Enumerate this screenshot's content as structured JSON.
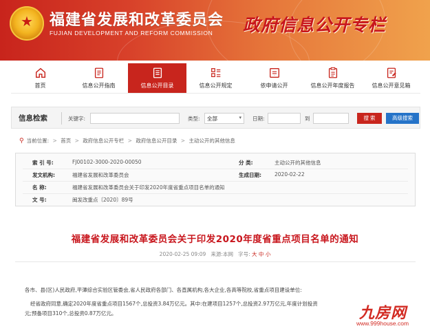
{
  "header": {
    "org_name_cn": "福建省发展和改革委员会",
    "org_name_en": "FUJIAN DEVELOPMENT AND REFORM COMMISSION",
    "column_title": "政府信息公开专栏",
    "brand_color": "#c8251d"
  },
  "nav": {
    "items": [
      {
        "label": "首页",
        "icon": "home-icon"
      },
      {
        "label": "信息公开指南",
        "icon": "guide-icon"
      },
      {
        "label": "信息公开目录",
        "icon": "catalog-icon",
        "active": true
      },
      {
        "label": "信息公开规定",
        "icon": "regulation-icon"
      },
      {
        "label": "依申请公开",
        "icon": "application-icon"
      },
      {
        "label": "信息公开年度报告",
        "icon": "report-icon"
      },
      {
        "label": "信息公开意见箱",
        "icon": "mailbox-icon"
      }
    ]
  },
  "search": {
    "title": "信息检索",
    "keyword_label": "关键字:",
    "keyword_value": "",
    "type_label": "类型:",
    "type_value": "全部",
    "date_label": "日期:",
    "date_to_label": "到",
    "search_button": "搜 索",
    "advanced_button": "高级搜索",
    "search_button_color": "#c8251d",
    "advanced_button_color": "#2573c8"
  },
  "breadcrumb": {
    "prefix": "当前位置:",
    "items": [
      "首页",
      "政府信息公开专栏",
      "政府信息公开目录",
      "主动公开的其他信息"
    ]
  },
  "info": {
    "index_label": "索 引 号:",
    "index_value": "FJ00102-3000-2020-00050",
    "category_label": "分 类:",
    "category_value": "主动公开的其他信息",
    "publisher_label": "发文机构:",
    "publisher_value": "福建省发展和改革委员会",
    "date_label": "生成日期:",
    "date_value": "2020-02-22",
    "name_label": "名 称:",
    "name_value": "福建省发展和改革委员会关于印发2020年度省重点项目名单的通知",
    "docno_label": "文 号:",
    "docno_value": "闽发改重点〔2020〕89号"
  },
  "article": {
    "title": "福建省发展和改革委员会关于印发2020年度省重点项目名单的通知",
    "date": "2020-02-25 09:09",
    "source_label": "来源:",
    "source_value": "本网",
    "size_label": "字号:",
    "size_large": "大",
    "size_medium": "中",
    "size_small": "小",
    "paragraph_1": "各市、县(区)人民政府,平潭综合实验区管委会,省人民政府各部门、各直属机构,各大企业,各高等院校,省重点项目建设单位:",
    "paragraph_2": "经省政府同意,确定2020年度省重点项目1567个,总投资3.84万亿元。其中:在建项目1257个,总投资2.97万亿元,年度计划投资",
    "paragraph_3": "元;预备项目310个,总投资0.87万亿元。"
  },
  "watermark": {
    "logo": "九房网",
    "url": "www.999house.com"
  }
}
